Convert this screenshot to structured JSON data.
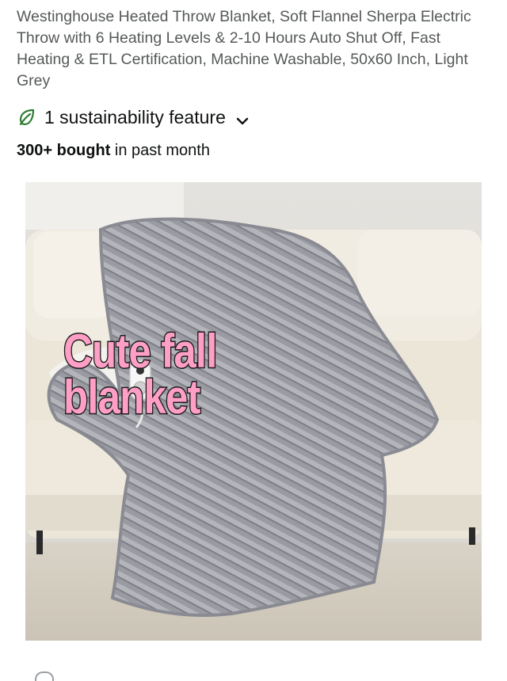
{
  "product": {
    "title": "Westinghouse Heated Throw Blanket, Soft Flannel Sherpa Electric Throw with 6 Heating Levels & 2-10 Hours Auto Shut Off, Fast Heating & ETL Certification, Machine Washable, 50x60 Inch, Light Grey"
  },
  "sustainability": {
    "label": "1 sustainability feature",
    "icon": "leaf-icon",
    "color": "#2e7d32"
  },
  "purchases": {
    "count": "300+ bought",
    "suffix": " in past month"
  },
  "image": {
    "overlay_line1": "Cute fall",
    "overlay_line2": "blanket",
    "overlay_color": "#ff9fc5"
  }
}
